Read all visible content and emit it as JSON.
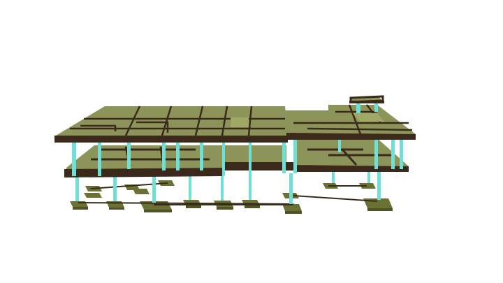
{
  "scene": {
    "colors": {
      "background": "#ffffff",
      "slab_top": "#8c9459",
      "slab_top_light": "#a0a865",
      "slab_edge": "#3b2a1a",
      "beam": "#3a2a1b",
      "column": "#6fe0d8",
      "column_shade": "#3fb8b0",
      "footing_top": "#6b7034",
      "footing_side": "#4f5326"
    }
  }
}
